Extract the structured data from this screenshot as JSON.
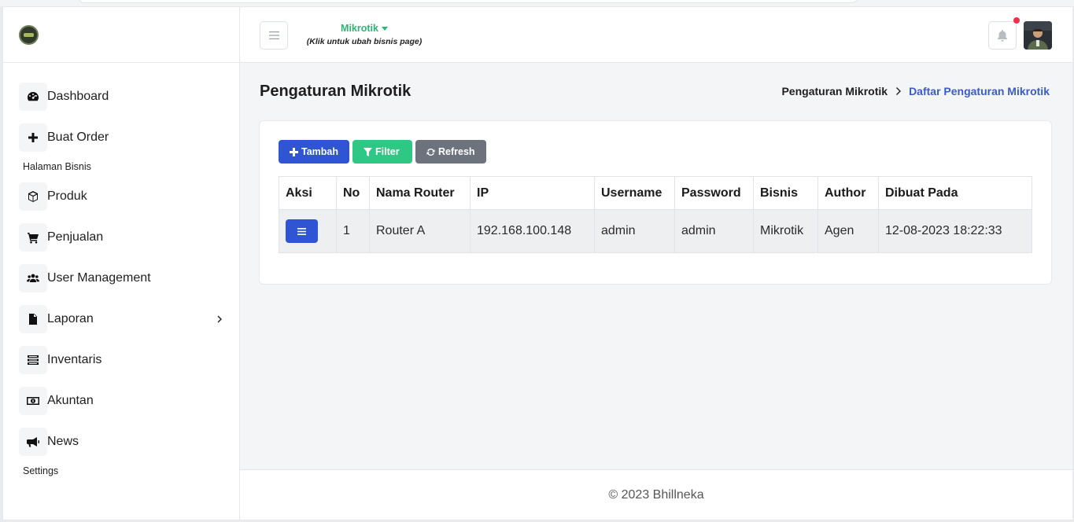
{
  "brand": {
    "logo": "company-logo"
  },
  "sidebar": {
    "items": [
      {
        "label": "Dashboard",
        "icon": "dashboard-icon"
      },
      {
        "label": "Buat Order",
        "icon": "plus-icon"
      },
      {
        "label": "Produk",
        "icon": "box-icon"
      },
      {
        "label": "Penjualan",
        "icon": "cart-icon"
      },
      {
        "label": "User Management",
        "icon": "users-icon"
      },
      {
        "label": "Laporan",
        "icon": "file-icon"
      },
      {
        "label": "Inventaris",
        "icon": "list-icon"
      },
      {
        "label": "Akuntan",
        "icon": "money-icon"
      },
      {
        "label": "News",
        "icon": "megaphone-icon"
      }
    ],
    "sections": [
      "Halaman Bisnis",
      "Settings"
    ]
  },
  "topbar": {
    "business_name": "Mikrotik",
    "business_hint": "(Klik untuk ubah bisnis page)"
  },
  "page": {
    "title": "Pengaturan Mikrotik",
    "breadcrumb": [
      "Pengaturan Mikrotik",
      "Daftar Pengaturan Mikrotik"
    ]
  },
  "toolbar": {
    "add_label": "Tambah",
    "filter_label": "Filter",
    "refresh_label": "Refresh"
  },
  "table": {
    "columns": [
      "Aksi",
      "No",
      "Nama Router",
      "IP",
      "Username",
      "Password",
      "Bisnis",
      "Author",
      "Dibuat Pada"
    ],
    "rows": [
      {
        "no": "1",
        "nama_router": "Router A",
        "ip": "192.168.100.148",
        "username": "admin",
        "password": "admin",
        "bisnis": "Mikrotik",
        "author": "Agen",
        "dibuat_pada": "12-08-2023 18:22:33"
      }
    ]
  },
  "footer": {
    "copyright": "© 2023 Bhillneka"
  },
  "colors": {
    "primary": "#2f55d4",
    "success": "#2ec784",
    "secondary": "#6c737d",
    "link": "#3a5cc7",
    "notification": "#ef2f4b"
  }
}
